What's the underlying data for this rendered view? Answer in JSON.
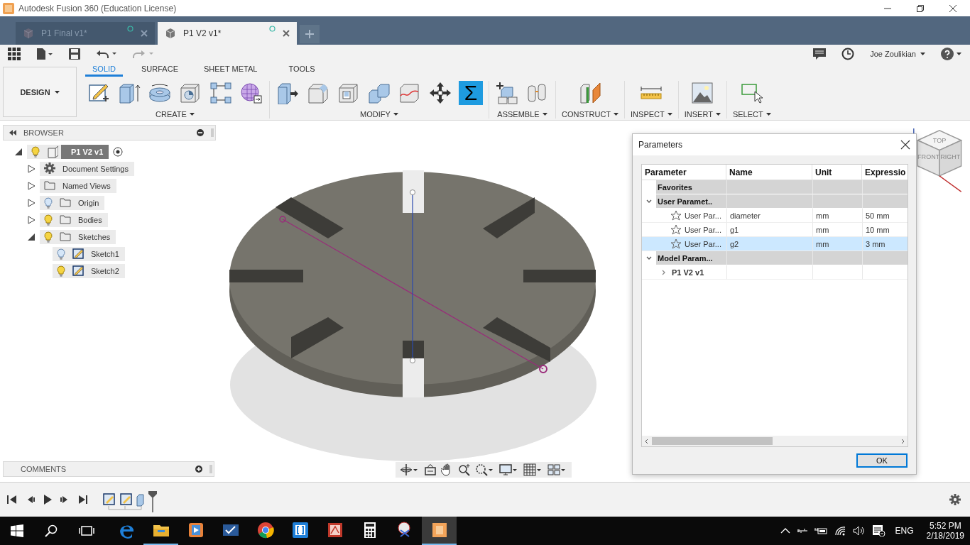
{
  "window": {
    "title": "Autodesk Fusion 360 (Education License)"
  },
  "document_tabs": [
    {
      "label": "P1 Final v1*",
      "selected": false
    },
    {
      "label": "P1 V2 v1*",
      "selected": true
    }
  ],
  "user": {
    "name": "Joe Zoulikian"
  },
  "workspace": {
    "label": "DESIGN"
  },
  "ribbon_tabs": [
    {
      "label": "SOLID",
      "selected": true
    },
    {
      "label": "SURFACE",
      "selected": false
    },
    {
      "label": "SHEET METAL",
      "selected": false
    },
    {
      "label": "TOOLS",
      "selected": false
    }
  ],
  "tool_groups": [
    {
      "label": "CREATE",
      "tools": [
        {
          "selected": false
        },
        {
          "selected": false
        },
        {
          "selected": false
        },
        {
          "selected": false
        },
        {
          "selected": false
        },
        {
          "selected": false
        }
      ]
    },
    {
      "label": "MODIFY",
      "tools": [
        {
          "selected": false
        },
        {
          "selected": false
        },
        {
          "selected": false
        },
        {
          "selected": false
        },
        {
          "selected": false
        },
        {
          "selected": false
        },
        {
          "symbol": "Σ",
          "selected": true
        }
      ]
    },
    {
      "label": "ASSEMBLE",
      "tools": [
        {
          "selected": false
        },
        {
          "selected": false
        }
      ]
    },
    {
      "label": "CONSTRUCT",
      "tools": [
        {
          "selected": false
        }
      ]
    },
    {
      "label": "INSPECT",
      "tools": [
        {
          "selected": false
        }
      ]
    },
    {
      "label": "INSERT",
      "tools": [
        {
          "selected": false
        }
      ]
    },
    {
      "label": "SELECT",
      "tools": [
        {
          "selected": false
        }
      ]
    }
  ],
  "browser": {
    "title": "BROWSER",
    "root": {
      "kind": "component",
      "label": "P1 V2 v1",
      "expanded": true,
      "visible": true,
      "children": [
        {
          "kind": "settings",
          "label": "Document Settings",
          "expanded": false
        },
        {
          "kind": "folder",
          "label": "Named Views",
          "expanded": false
        },
        {
          "kind": "folder",
          "label": "Origin",
          "expanded": false,
          "visible": false
        },
        {
          "kind": "folder",
          "label": "Bodies",
          "expanded": false,
          "visible": true
        },
        {
          "kind": "folder",
          "label": "Sketches",
          "expanded": true,
          "visible": true,
          "children": [
            {
              "kind": "sketch",
              "label": "Sketch1",
              "visible": false
            },
            {
              "kind": "sketch",
              "label": "Sketch2",
              "visible": true
            }
          ]
        }
      ]
    }
  },
  "comments": {
    "title": "COMMENTS"
  },
  "viewcube": {
    "faces": [
      "TOP",
      "FRONT",
      "RIGHT"
    ]
  },
  "parameters_dialog": {
    "title": "Parameters",
    "columns": [
      "Parameter",
      "Name",
      "Unit",
      "Expressio"
    ],
    "sections": [
      {
        "label": "Favorites"
      },
      {
        "label": "User Paramet..",
        "expanded": true,
        "rows": [
          {
            "kind": "parameter",
            "parameter": "User Par...",
            "name": "diameter",
            "unit": "mm",
            "expression": "50 mm",
            "favorite": false,
            "selected": false
          },
          {
            "kind": "parameter",
            "parameter": "User Par...",
            "name": "g1",
            "unit": "mm",
            "expression": "10 mm",
            "favorite": false,
            "selected": false
          },
          {
            "kind": "parameter",
            "parameter": "User Par...",
            "name": "g2",
            "unit": "mm",
            "expression": "3 mm",
            "favorite": false,
            "selected": true
          }
        ]
      },
      {
        "label": "Model Param...",
        "expanded": true,
        "rows": [
          {
            "kind": "component",
            "parameter": "P1 V2 v1",
            "expanded": false
          }
        ]
      }
    ],
    "buttons": [
      "OK"
    ]
  },
  "taskbar": {
    "apps": [
      {
        "running": false,
        "active": false
      },
      {
        "running": true,
        "active": false
      },
      {
        "running": false,
        "active": false
      },
      {
        "running": false,
        "active": false
      },
      {
        "running": false,
        "active": false
      },
      {
        "running": false,
        "active": false
      },
      {
        "running": false,
        "active": false
      },
      {
        "running": false,
        "active": false
      },
      {
        "running": false,
        "active": false
      },
      {
        "running": true,
        "active": true
      }
    ],
    "language": "ENG",
    "time": "5:52 PM",
    "date": "2/18/2019"
  }
}
